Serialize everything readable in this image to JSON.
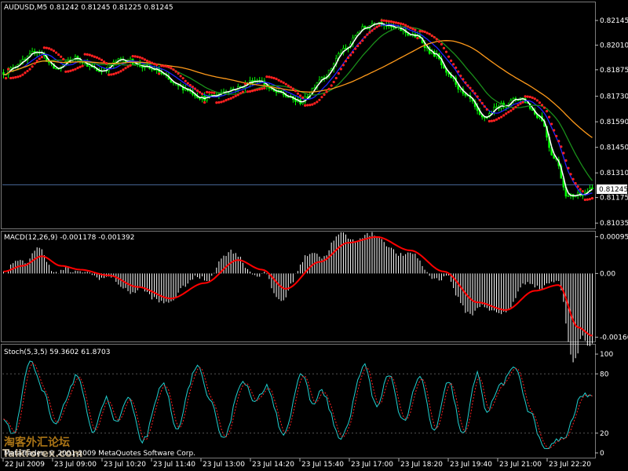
{
  "chart_data": [
    {
      "type": "candlestick",
      "panel": "price",
      "symbol_label": "AUDUSD,M5",
      "ohlc_label": "0.81242 0.81245 0.81225 0.81245",
      "current_price": 0.81245,
      "current_price_label": "0.81245",
      "y_range": [
        0.8101,
        0.8224
      ],
      "y_ticks": [
        "0.82145",
        "0.82010",
        "0.81875",
        "0.81730",
        "0.81590",
        "0.81450",
        "0.81310",
        "0.81175",
        "0.81035"
      ],
      "y_tick_values": [
        0.82145,
        0.8201,
        0.81875,
        0.8173,
        0.8159,
        0.8145,
        0.8131,
        0.81175,
        0.81035
      ],
      "anchors": [
        [
          0,
          0.8186
        ],
        [
          8,
          0.8192
        ],
        [
          14,
          0.8198
        ],
        [
          22,
          0.8188
        ],
        [
          30,
          0.8194
        ],
        [
          40,
          0.8187
        ],
        [
          50,
          0.8193
        ],
        [
          62,
          0.8188
        ],
        [
          74,
          0.8178
        ],
        [
          84,
          0.8172
        ],
        [
          96,
          0.8177
        ],
        [
          106,
          0.8182
        ],
        [
          114,
          0.8175
        ],
        [
          124,
          0.817
        ],
        [
          134,
          0.8184
        ],
        [
          142,
          0.8198
        ],
        [
          150,
          0.821
        ],
        [
          156,
          0.8214
        ],
        [
          164,
          0.821
        ],
        [
          172,
          0.8206
        ],
        [
          180,
          0.8196
        ],
        [
          186,
          0.8184
        ],
        [
          194,
          0.8172
        ],
        [
          200,
          0.8161
        ],
        [
          208,
          0.8168
        ],
        [
          216,
          0.8172
        ],
        [
          224,
          0.8162
        ],
        [
          230,
          0.814
        ],
        [
          236,
          0.8118
        ],
        [
          242,
          0.812
        ],
        [
          246,
          0.8122
        ]
      ],
      "series": [
        {
          "name": "ma-white",
          "color": "#ffffff",
          "lag": 3
        },
        {
          "name": "ma-blue",
          "color": "#2222ff",
          "lag": 9
        },
        {
          "name": "ma-green",
          "color": "#1a8f1a",
          "lag": 20
        },
        {
          "name": "ma-orange",
          "color": "#ff9a1a",
          "lag": 50
        }
      ],
      "sar_color": "#ff2020",
      "candle_color": "#00ff00"
    },
    {
      "type": "bar-line",
      "panel": "macd",
      "label": "MACD(12,26,9) -0.001178 -0.001392",
      "y_range": [
        -0.00175,
        0.00105
      ],
      "y_ticks": [
        "0.000956",
        "0.00",
        "-0.00166"
      ],
      "y_tick_values": [
        0.000956,
        0,
        -0.00166
      ],
      "anchors": [
        [
          0,
          5e-05
        ],
        [
          8,
          0.0002
        ],
        [
          16,
          0.00045
        ],
        [
          24,
          0.0002
        ],
        [
          32,
          0.0001
        ],
        [
          44,
          -5e-05
        ],
        [
          56,
          -0.00035
        ],
        [
          70,
          -0.00065
        ],
        [
          84,
          -0.00025
        ],
        [
          98,
          0.00035
        ],
        [
          108,
          0.0001
        ],
        [
          118,
          -0.0004
        ],
        [
          132,
          0.0003
        ],
        [
          144,
          0.0008
        ],
        [
          156,
          0.00095
        ],
        [
          170,
          0.0006
        ],
        [
          184,
          5e-05
        ],
        [
          198,
          -0.00075
        ],
        [
          210,
          -0.00095
        ],
        [
          222,
          -0.00045
        ],
        [
          232,
          -0.0003
        ],
        [
          240,
          -0.0014
        ],
        [
          246,
          -0.00162
        ]
      ],
      "bar_color": "#ffffff",
      "signal_color": "#ff0000"
    },
    {
      "type": "line",
      "panel": "stochastic",
      "label": "Stoch(5,3,5) 59.3602 61.8703",
      "y_range": [
        -4,
        108
      ],
      "y_ticks": [
        "100",
        "80",
        "20",
        "0"
      ],
      "y_tick_values": [
        100,
        80,
        20,
        0
      ],
      "anchors": [
        [
          0,
          35
        ],
        [
          4,
          20
        ],
        [
          11,
          92
        ],
        [
          17,
          60
        ],
        [
          21,
          28
        ],
        [
          31,
          78
        ],
        [
          37,
          22
        ],
        [
          43,
          55
        ],
        [
          47,
          30
        ],
        [
          52,
          55
        ],
        [
          58,
          12
        ],
        [
          67,
          70
        ],
        [
          72,
          25
        ],
        [
          81,
          88
        ],
        [
          86,
          52
        ],
        [
          92,
          16
        ],
        [
          100,
          74
        ],
        [
          105,
          50
        ],
        [
          110,
          68
        ],
        [
          117,
          20
        ],
        [
          125,
          80
        ],
        [
          129,
          50
        ],
        [
          133,
          62
        ],
        [
          141,
          14
        ],
        [
          151,
          88
        ],
        [
          156,
          45
        ],
        [
          161,
          80
        ],
        [
          167,
          32
        ],
        [
          174,
          76
        ],
        [
          180,
          22
        ],
        [
          186,
          72
        ],
        [
          192,
          18
        ],
        [
          198,
          80
        ],
        [
          202,
          42
        ],
        [
          208,
          70
        ],
        [
          214,
          86
        ],
        [
          220,
          40
        ],
        [
          226,
          4
        ],
        [
          234,
          15
        ],
        [
          242,
          58
        ],
        [
          246,
          60
        ]
      ],
      "series": [
        {
          "name": "main",
          "color": "#20d0d0",
          "shift": 0
        },
        {
          "name": "signal",
          "color": "#ff2020",
          "shift": 2
        }
      ]
    }
  ],
  "x_ticks": [
    "22 Jul 2009",
    "23 Jul 09:00",
    "23 Jul 10:20",
    "23 Jul 11:40",
    "23 Jul 13:00",
    "23 Jul 14:20",
    "23 Jul 15:40",
    "23 Jul 17:00",
    "23 Jul 18:20",
    "23 Jul 19:40",
    "23 Jul 21:00",
    "23 Jul 22:20"
  ],
  "bars_count": 247,
  "copyright": "MetaTrader, © 2001-2009 MetaQuotes Software Corp.",
  "watermark": {
    "cn": "淘客外汇论坛",
    "url": "Talkforex.com"
  }
}
